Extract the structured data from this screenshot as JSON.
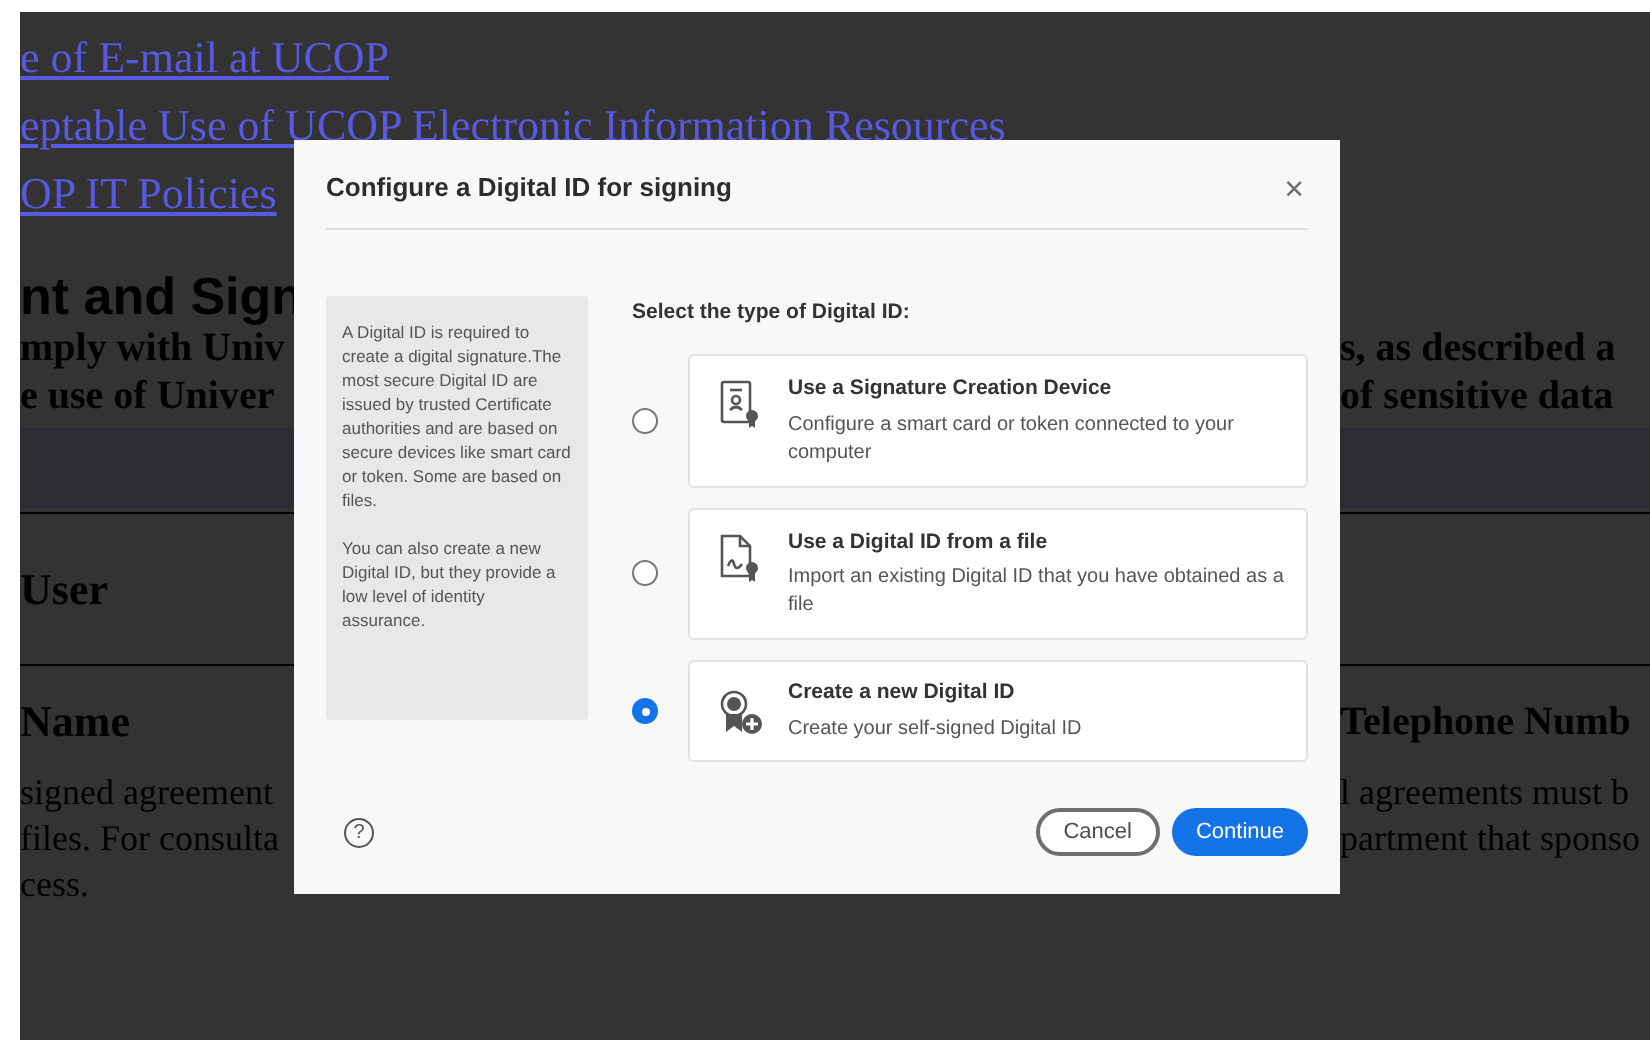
{
  "page": {
    "links": [
      "e of E-mail at UCOP",
      "eptable Use of UCOP Electronic Information Resources",
      "OP IT Policies"
    ],
    "heading": "nt and Sign",
    "intro_left": [
      "mply with Univ",
      "e use of Univer"
    ],
    "intro_right": [
      "s, as described a",
      "of sensitive data"
    ],
    "user_heading": "User",
    "name_heading": "Name",
    "phone_heading": "Telephone Numb",
    "body_left": [
      "signed agreement",
      "files. For consulta",
      "cess."
    ],
    "body_right": [
      "l agreements must b",
      "partment that sponso"
    ]
  },
  "dialog": {
    "title": "Configure a Digital ID for signing",
    "close": "×",
    "info": [
      "A Digital ID is required to create a digital signature.The most secure Digital ID are issued by trusted Certificate authorities and are based on secure devices like smart card or token. Some are based on files.",
      "You can also create a new Digital ID, but they provide a low level of identity assurance."
    ],
    "prompt": "Select the type of Digital ID:",
    "options": [
      {
        "kind": "device",
        "title": "Use a Signature Creation Device",
        "description": "Configure a smart card or token connected to your computer",
        "selected": false
      },
      {
        "kind": "file",
        "title": "Use a Digital ID from a file",
        "description": "Import an existing Digital ID that you have obtained as a file",
        "selected": false
      },
      {
        "kind": "new",
        "title": "Create a new Digital ID",
        "description": "Create your self-signed Digital ID",
        "selected": true
      }
    ],
    "help": "?",
    "buttons": [
      {
        "kind": "secondary",
        "label": "Cancel"
      },
      {
        "kind": "primary",
        "label": "Continue"
      }
    ]
  }
}
